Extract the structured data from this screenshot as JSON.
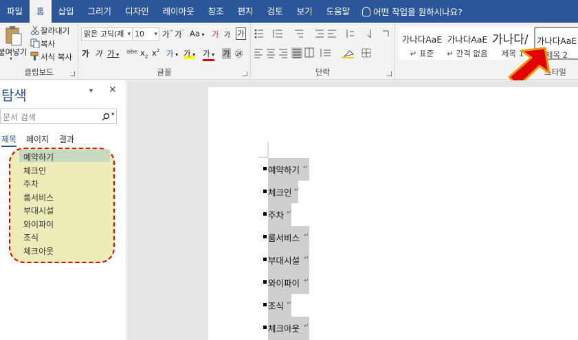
{
  "tabs": [
    "파일",
    "홈",
    "삽입",
    "그리기",
    "디자인",
    "레이아웃",
    "참조",
    "편지",
    "검토",
    "보기",
    "도움말"
  ],
  "tell_me": "어떤 작업을 원하시나요?",
  "clipboard": {
    "paste": "붙여넣기",
    "cut": "잘라내기",
    "copy": "복사",
    "format_painter": "서식 복사",
    "label": "클립보드"
  },
  "font": {
    "name": "맑은 고딕(제",
    "size": "10",
    "grow": "가",
    "shrink": "가",
    "case": "Aa",
    "clear": "가",
    "phonetic": "가",
    "border": "가",
    "bold": "가",
    "italic": "가",
    "underline": "가",
    "strike": "abc",
    "sub": "x",
    "sup": "x",
    "effects": "가",
    "highlight": "가",
    "color": "가",
    "shade": "가",
    "enclose": "㉔",
    "label": "글꼴"
  },
  "paragraph": {
    "label": "단락"
  },
  "styles": {
    "items": [
      {
        "sample": "가나다AaE",
        "name": "↵ 표준"
      },
      {
        "sample": "가나다AaE",
        "name": "↵ 간격 없음"
      },
      {
        "sample": "가나다/",
        "name": "제목 1"
      },
      {
        "sample": "가나다AaE",
        "name": "제목 2"
      }
    ],
    "label": "스타일"
  },
  "nav": {
    "title": "탐색",
    "search_placeholder": "문서 검색",
    "tabs": [
      "제목",
      "페이지",
      "결과"
    ],
    "headings": [
      "예약하기",
      "체크인",
      "주차",
      "룸서비스",
      "부대시설",
      "와이파이",
      "조식",
      "체크아웃"
    ]
  },
  "document": {
    "lines": [
      "예약하기",
      "체크인",
      "주차",
      "룸서비스",
      "부대시설",
      "와이파이",
      "조식",
      "체크아웃"
    ]
  },
  "colors": {
    "accent": "#2b579a",
    "annotation_red": "#e00000",
    "arrow_orange": "#f29400",
    "nav_highlight": "#eeecb8"
  }
}
